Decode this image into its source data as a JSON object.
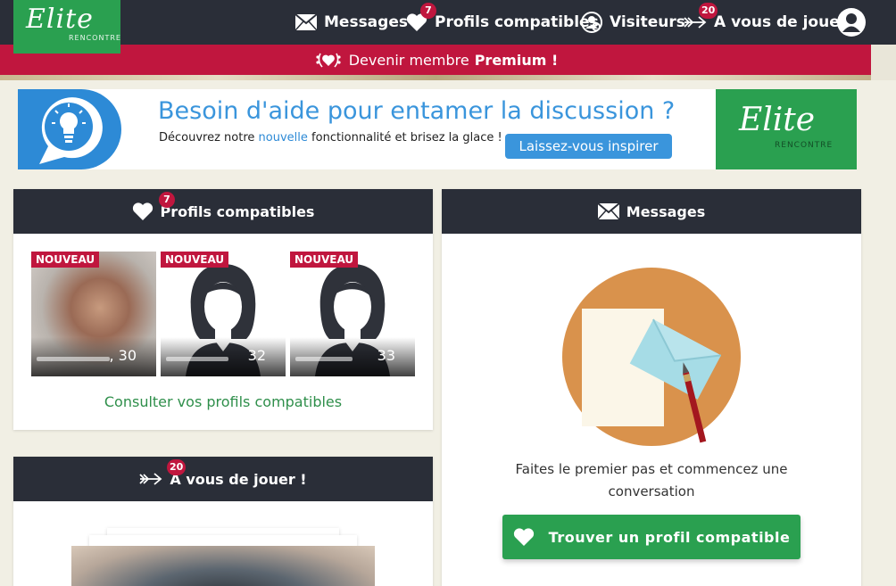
{
  "logo": {
    "word": "Elite",
    "sub": "RENCONTRE"
  },
  "nav": {
    "messages": "Messages",
    "profils": "Profils compatibles",
    "profils_badge": "7",
    "visiteurs": "Visiteurs",
    "jouer": "A vous de jouer !",
    "jouer_badge": "20"
  },
  "premium": {
    "text": "Devenir membre",
    "bold": "Premium !"
  },
  "banner": {
    "title": "Besoin d'aide pour entamer la discussion ?",
    "desc_before": "Découvrez notre",
    "desc_highlight": "nouvelle",
    "desc_after": "fonctionnalité et brisez la glace !",
    "button": "Laissez-vous inspirer",
    "logo_word": "Elite",
    "logo_sub": "RENCONTRE"
  },
  "profils_card": {
    "title": "Profils compatibles",
    "badge": "7",
    "profiles": [
      {
        "tag": "NOUVEAU",
        "age": ", 30"
      },
      {
        "tag": "NOUVEAU",
        "age": "32"
      },
      {
        "tag": "NOUVEAU",
        "age": "33"
      }
    ],
    "link": "Consulter vos profils compatibles"
  },
  "jouer_card": {
    "title": "A vous de jouer !",
    "badge": "20"
  },
  "messages_card": {
    "title": "Messages",
    "text_line1": "Faites le premier pas et commencez une",
    "text_line2": "conversation",
    "button": "Trouver un profil compatible"
  },
  "colors": {
    "nav_bg": "#2a2e38",
    "brand_green": "#2aa050",
    "premium_red": "#c0163e",
    "accent_blue": "#3a95dc",
    "page_bg": "#f1efe4"
  },
  "icons": {
    "messages": "envelope-icon",
    "profils": "heart-icon",
    "visiteurs": "visitor-icon",
    "jouer": "arrow-icon",
    "account": "user-icon",
    "premium": "laurel-heart-icon",
    "banner": "lightbulb-icon"
  }
}
